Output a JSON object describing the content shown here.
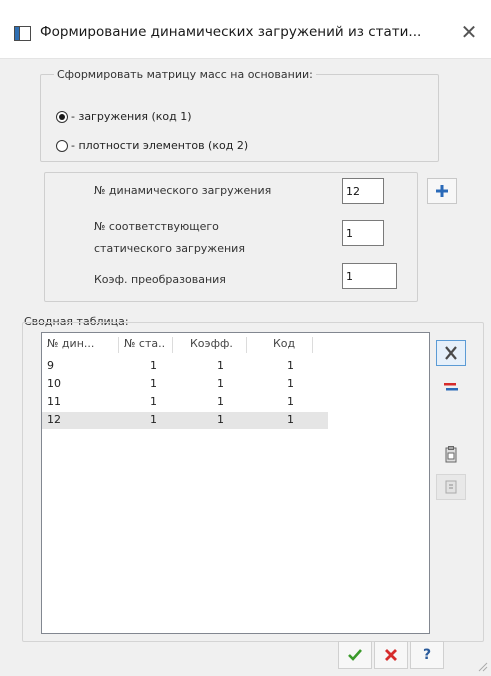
{
  "window": {
    "title": "Формирование динамических загружений из стати...",
    "icon": "app-window-icon",
    "close_icon": "close-icon"
  },
  "mass_matrix": {
    "group_title": "Сформировать матрицу масс на основании:",
    "options": [
      {
        "label": "- загружения (код 1)",
        "checked": true
      },
      {
        "label": "- плотности элементов (код 2)",
        "checked": false
      }
    ]
  },
  "params": {
    "dyn_load_label": "№ динамического загружения",
    "dyn_load_value": "12",
    "static_load_label_1": "№ соответствующего",
    "static_load_label_2": "статического загружения",
    "static_load_value": "1",
    "coef_label": "Коэф. преобразования",
    "coef_value": "1",
    "add_icon": "plus-icon"
  },
  "summary": {
    "title": "Сводная таблица:",
    "columns": [
      "№ дин...",
      "№ ста..",
      "Коэфф.",
      "Код"
    ],
    "rows": [
      [
        "9",
        "1",
        "1",
        "1"
      ],
      [
        "10",
        "1",
        "1",
        "1"
      ],
      [
        "11",
        "1",
        "1",
        "1"
      ],
      [
        "12",
        "1",
        "1",
        "1"
      ]
    ],
    "selected_row": 3
  },
  "side_tools": {
    "delete_icon": "delete-x-icon",
    "edit_icon": "edit-rows-icon",
    "copy_icon": "copy-icon",
    "paste_icon": "paste-icon"
  },
  "bottom": {
    "ok_icon": "check-icon",
    "cancel_icon": "cancel-x-icon",
    "help_label": "?"
  },
  "colors": {
    "ok_green": "#3a9a2a",
    "cancel_red": "#d62b2b",
    "plus_blue": "#2a6ab8",
    "accent_blue": "#5b9bd5"
  }
}
